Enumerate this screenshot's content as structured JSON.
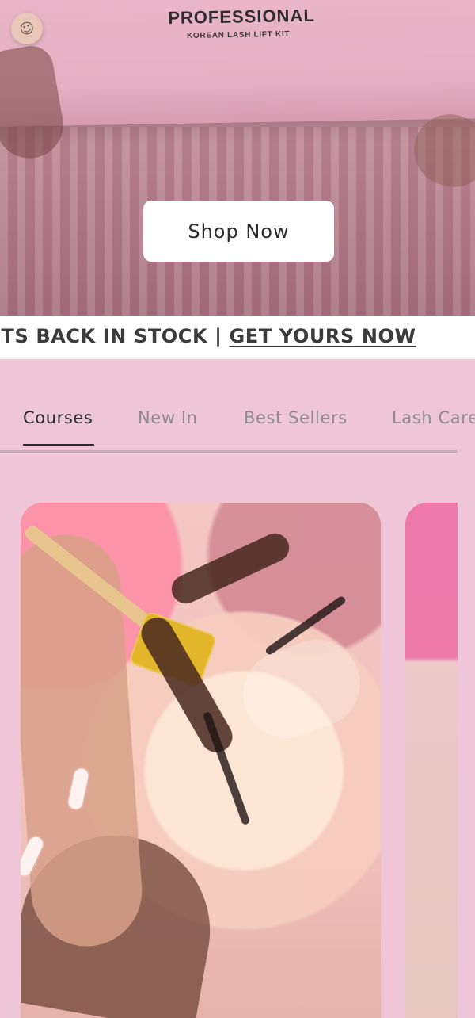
{
  "hero": {
    "box_title": "PROFESSIONAL",
    "box_subtitle": "KOREAN LASH LIFT KIT",
    "cta_label": "Shop Now"
  },
  "announcement": {
    "prefix": "ITS BACK IN STOCK | ",
    "cta": "GET YOURS NOW"
  },
  "tabs": [
    {
      "label": "Courses"
    },
    {
      "label": "New In"
    },
    {
      "label": "Best Sellers"
    },
    {
      "label": "Lash Care"
    }
  ],
  "colors": {
    "page_bg": "#efc6d8",
    "tab_inactive": "#8f8a8d",
    "tab_active": "#2a2a2a",
    "announcement_text": "#3b3b3b"
  },
  "icons": {
    "nail_art": "smiley-face-icon"
  }
}
